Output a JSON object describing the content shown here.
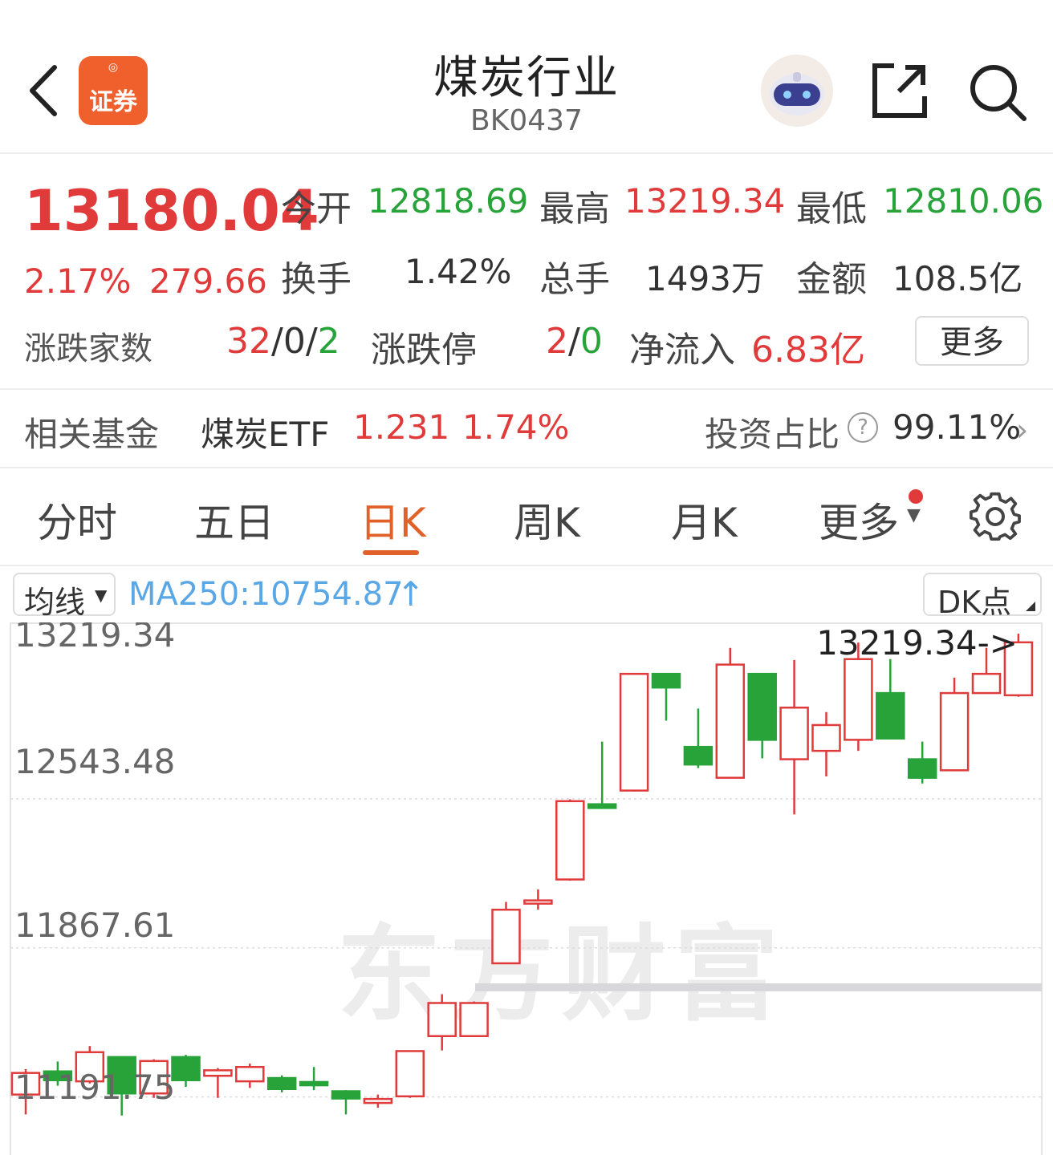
{
  "header": {
    "title": "煤炭行业",
    "code": "BK0437",
    "logo_text": "证券"
  },
  "quote": {
    "price": "13180.04",
    "change_pct": "2.17%",
    "change_abs": "279.66",
    "open_label": "今开",
    "open": "12818.69",
    "high_label": "最高",
    "high": "13219.34",
    "low_label": "最低",
    "low": "12810.06",
    "turnover_label": "换手",
    "turnover": "1.42%",
    "volume_label": "总手",
    "volume": "1493万",
    "amount_label": "金额",
    "amount": "108.5亿",
    "updown_label": "涨跌家数",
    "up_count": "32",
    "flat_count": "0",
    "down_count": "2",
    "limit_label": "涨跌停",
    "limit_up": "2",
    "limit_down": "0",
    "netflow_label": "净流入",
    "netflow": "6.83亿",
    "more_label": "更多"
  },
  "fund": {
    "label": "相关基金",
    "name": "煤炭ETF",
    "price": "1.231",
    "change": "1.74%",
    "ratio_label": "投资占比",
    "ratio": "99.11%"
  },
  "tabs": [
    {
      "label": "分时"
    },
    {
      "label": "五日"
    },
    {
      "label": "日K"
    },
    {
      "label": "周K"
    },
    {
      "label": "月K"
    },
    {
      "label": "更多"
    }
  ],
  "chart_controls": {
    "ma_selector": "均线",
    "ma_value": "MA250:10754.87",
    "dk_label": "DK点"
  },
  "watermark": "东方财富",
  "colors": {
    "up": "#e03a3a",
    "down": "#27a33a",
    "accent": "#e0622a",
    "ma": "#5aa7e6"
  },
  "chart_data": {
    "type": "candlestick",
    "y_ticks": [
      "13219.34",
      "12543.48",
      "11867.61",
      "11191.75"
    ],
    "ylim": [
      10856,
      13219.34
    ],
    "high_annotation": "13219.34->",
    "candles": [
      {
        "o": 11130,
        "c": 11228,
        "h": 11245,
        "l": 11040
      },
      {
        "o": 11235,
        "c": 11195,
        "h": 11280,
        "l": 11170
      },
      {
        "o": 11190,
        "c": 11322,
        "h": 11350,
        "l": 11180
      },
      {
        "o": 11300,
        "c": 11135,
        "h": 11300,
        "l": 11035
      },
      {
        "o": 11135,
        "c": 11282,
        "h": 11290,
        "l": 11115
      },
      {
        "o": 11300,
        "c": 11195,
        "h": 11310,
        "l": 11165
      },
      {
        "o": 11215,
        "c": 11240,
        "h": 11250,
        "l": 11115
      },
      {
        "o": 11190,
        "c": 11255,
        "h": 11270,
        "l": 11160
      },
      {
        "o": 11205,
        "c": 11155,
        "h": 11217,
        "l": 11140
      },
      {
        "o": 11187,
        "c": 11172,
        "h": 11255,
        "l": 11150
      },
      {
        "o": 11145,
        "c": 11112,
        "h": 11150,
        "l": 11040
      },
      {
        "o": 11092,
        "c": 11110,
        "h": 11130,
        "l": 11070
      },
      {
        "o": 11122,
        "c": 11327,
        "h": 11327,
        "l": 11115
      },
      {
        "o": 11395,
        "c": 11545,
        "h": 11585,
        "l": 11330
      },
      {
        "o": 11395,
        "c": 11545,
        "h": 11552,
        "l": 11395
      },
      {
        "o": 11725,
        "c": 11968,
        "h": 12003,
        "l": 11725
      },
      {
        "o": 12000,
        "c": 12010,
        "h": 12060,
        "l": 11968
      },
      {
        "o": 12105,
        "c": 12460,
        "h": 12468,
        "l": 12100
      },
      {
        "o": 12446,
        "c": 12429,
        "h": 12730,
        "l": 12429
      },
      {
        "o": 12508,
        "c": 13037,
        "h": 13037,
        "l": 12503
      },
      {
        "o": 13037,
        "c": 12975,
        "h": 13037,
        "l": 12825
      },
      {
        "o": 12706,
        "c": 12626,
        "h": 12880,
        "l": 12610
      },
      {
        "o": 12566,
        "c": 13079,
        "h": 13155,
        "l": 12566
      },
      {
        "o": 13037,
        "c": 12738,
        "h": 13037,
        "l": 12654
      },
      {
        "o": 12650,
        "c": 12884,
        "h": 13100,
        "l": 12400
      },
      {
        "o": 12688,
        "c": 12805,
        "h": 12864,
        "l": 12572
      },
      {
        "o": 12738,
        "c": 13104,
        "h": 13179,
        "l": 12688
      },
      {
        "o": 12950,
        "c": 12744,
        "h": 13104,
        "l": 12744
      },
      {
        "o": 12650,
        "c": 12566,
        "h": 12730,
        "l": 12540
      },
      {
        "o": 12600,
        "c": 12950,
        "h": 13020,
        "l": 12600
      },
      {
        "o": 12950,
        "c": 13037,
        "h": 13155,
        "l": 12950
      },
      {
        "o": 12940,
        "c": 13180,
        "h": 13219.34,
        "l": 12933
      }
    ]
  }
}
